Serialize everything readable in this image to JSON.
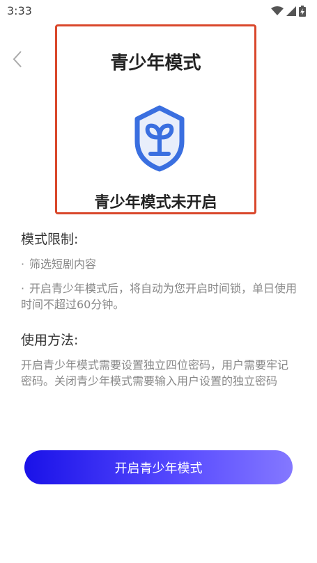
{
  "status_bar": {
    "time": "3:33",
    "icons": [
      "wifi-icon",
      "signal-icon",
      "battery-charging-icon"
    ]
  },
  "nav": {
    "back_icon": "chevron-left-icon"
  },
  "header": {
    "title": "青少年模式",
    "icon": "shield-sprout-icon",
    "status": "青少年模式未开启"
  },
  "restrictions": {
    "title": "模式限制:",
    "items": [
      "筛选短剧内容",
      "开启青少年模式后，将自动为您开启时间锁，单日使用时间不超过60分钟。"
    ]
  },
  "usage": {
    "title": "使用方法:",
    "text": "开启青少年模式需要设置独立四位密码，用户需要牢记密码。关闭青少年模式需要输入用户设置的独立密码"
  },
  "action": {
    "button_label": "开启青少年模式"
  },
  "colors": {
    "accent": "#1a12e8",
    "highlight_border": "#d9472b",
    "shield_blue": "#3a6fe0"
  }
}
